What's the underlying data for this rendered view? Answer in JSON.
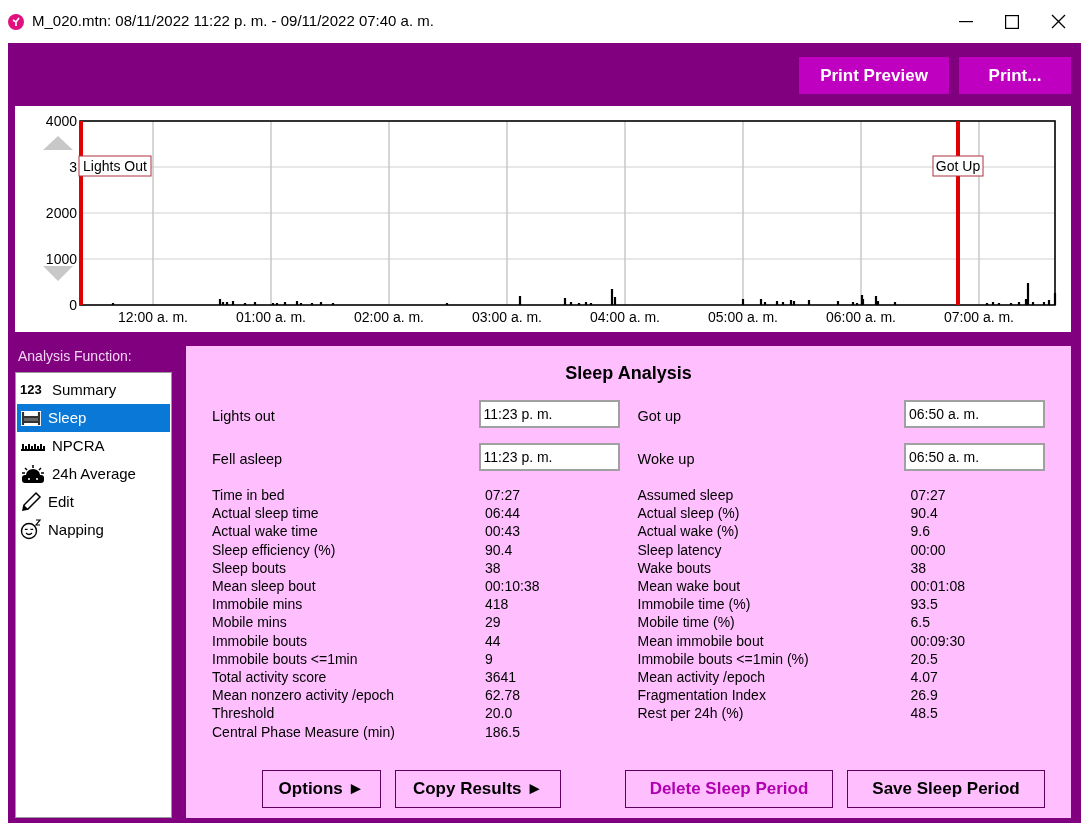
{
  "window": {
    "title": "M_020.mtn: 08/11/2022 11:22 p. m. - 09/11/2022 07:40 a. m."
  },
  "toolbar": {
    "buttons": [
      "Print Preview",
      "Print..."
    ]
  },
  "activity_plot": {
    "y_tick_labels": [
      "4000",
      "3",
      "2000",
      "1000",
      "0"
    ],
    "x_tick_labels": [
      "12:00 a. m.",
      "01:00 a. m.",
      "02:00 a. m.",
      "03:00 a. m.",
      "04:00 a. m.",
      "05:00 a. m.",
      "06:00 a. m.",
      "07:00 a. m."
    ],
    "markers": [
      {
        "label": "Lights Out",
        "kind": "start"
      },
      {
        "label": "Got Up",
        "kind": "end"
      }
    ]
  },
  "sidebar": {
    "title": "Analysis Function:",
    "items": [
      {
        "label": "Summary",
        "kind": "digits",
        "icon_text": "123",
        "selected": false
      },
      {
        "label": "Sleep",
        "kind": "bed",
        "selected": true
      },
      {
        "label": "NPCRA",
        "kind": "bars",
        "selected": false
      },
      {
        "label": "24h Average",
        "kind": "sun",
        "selected": false
      },
      {
        "label": "Edit",
        "kind": "pencil",
        "selected": false
      },
      {
        "label": "Napping",
        "kind": "face",
        "selected": false
      }
    ]
  },
  "panel": {
    "title": "Sleep Analysis",
    "fields": [
      {
        "label": "Lights out",
        "value": "11:23 p. m."
      },
      {
        "label": "Got up",
        "value": "06:50 a. m."
      },
      {
        "label": "Fell asleep",
        "value": "11:23 p. m."
      },
      {
        "label": "Woke up",
        "value": "06:50 a. m."
      }
    ],
    "left_stats": [
      {
        "label": "Time in bed",
        "value": "07:27"
      },
      {
        "label": "Actual sleep time",
        "value": "06:44"
      },
      {
        "label": "Actual wake time",
        "value": "00:43"
      },
      {
        "label": "Sleep efficiency (%)",
        "value": "90.4"
      },
      {
        "label": "Sleep bouts",
        "value": "38"
      },
      {
        "label": "Mean sleep bout",
        "value": "00:10:38"
      },
      {
        "label": "Immobile mins",
        "value": "418"
      },
      {
        "label": "Mobile mins",
        "value": "29"
      },
      {
        "label": "Immobile bouts",
        "value": "44"
      },
      {
        "label": "Immobile bouts <=1min",
        "value": "9"
      },
      {
        "label": "Total activity score",
        "value": "3641"
      },
      {
        "label": "Mean nonzero activity /epoch",
        "value": "62.78"
      },
      {
        "label": "Threshold",
        "value": "20.0"
      },
      {
        "label": "Central Phase Measure (min)",
        "value": "186.5"
      }
    ],
    "right_stats": [
      {
        "label": "Assumed sleep",
        "value": "07:27"
      },
      {
        "label": "Actual sleep (%)",
        "value": "90.4"
      },
      {
        "label": "Actual wake (%)",
        "value": "9.6"
      },
      {
        "label": "Sleep latency",
        "value": "00:00"
      },
      {
        "label": "Wake bouts",
        "value": "38"
      },
      {
        "label": "Mean wake bout",
        "value": "00:01:08"
      },
      {
        "label": "Immobile time (%)",
        "value": "93.5"
      },
      {
        "label": "Mobile time (%)",
        "value": "6.5"
      },
      {
        "label": "Mean immobile bout",
        "value": "00:09:30"
      },
      {
        "label": "Immobile bouts <=1min (%)",
        "value": "20.5"
      },
      {
        "label": "Mean activity /epoch",
        "value": "4.07"
      },
      {
        "label": "Fragmentation Index",
        "value": "26.9"
      },
      {
        "label": "Rest per 24h (%)",
        "value": "48.5"
      }
    ],
    "buttons": [
      {
        "label": "Options ►",
        "kind": "normal"
      },
      {
        "label": "Copy Results ►",
        "kind": "normal"
      },
      {
        "label": "Delete Sleep Period",
        "kind": "danger"
      },
      {
        "label": "Save Sleep Period",
        "kind": "normal"
      }
    ]
  }
}
